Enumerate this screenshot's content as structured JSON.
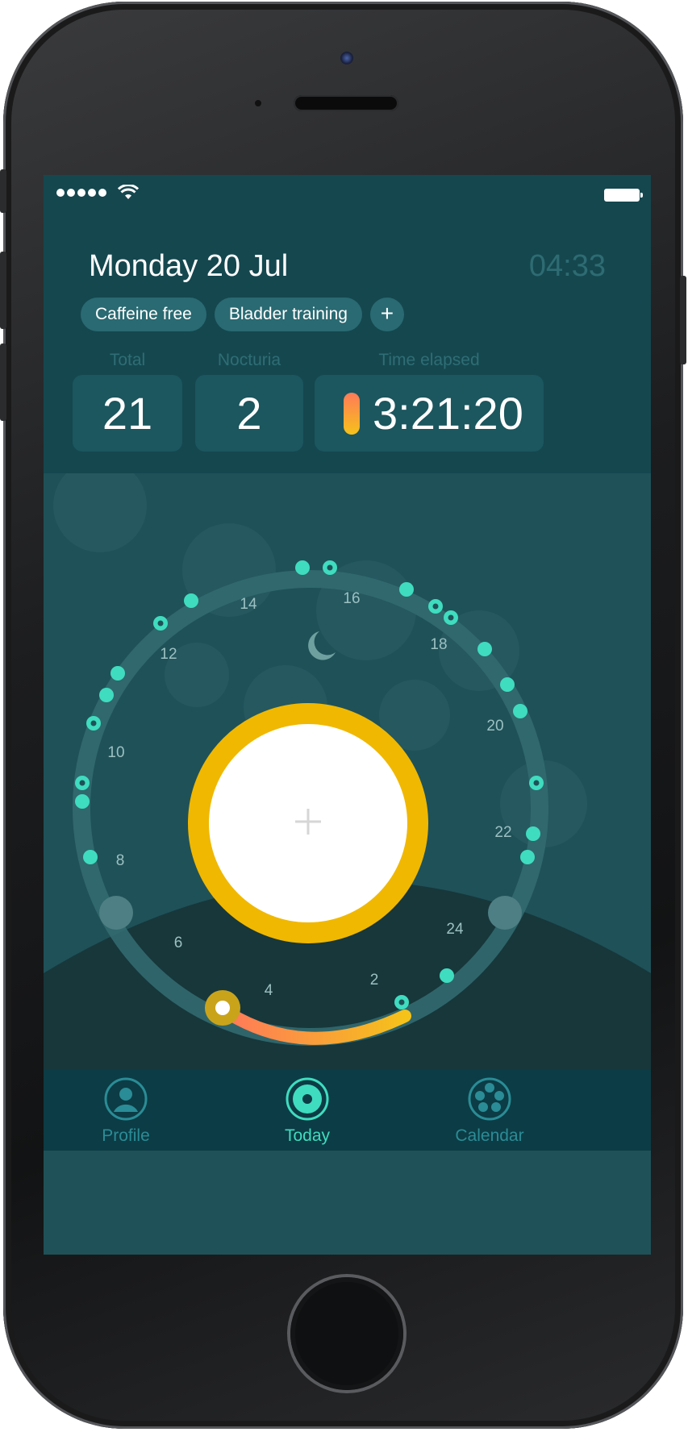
{
  "header": {
    "date": "Monday 20 Jul",
    "time": "04:33",
    "chips": [
      "Caffeine free",
      "Bladder training"
    ],
    "add_chip": "+"
  },
  "stats": {
    "total_label": "Total",
    "total_value": "21",
    "nocturia_label": "Nocturia",
    "nocturia_value": "2",
    "elapsed_label": "Time elapsed",
    "elapsed_value": "3:21:20"
  },
  "clock": {
    "hour_labels": [
      "2",
      "4",
      "6",
      "8",
      "10",
      "12",
      "14",
      "16",
      "18",
      "20",
      "22",
      "24"
    ],
    "center_icon": "plus-icon",
    "moon_icon": "moon-icon"
  },
  "tabs": [
    {
      "label": "Profile",
      "icon": "profile-icon",
      "active": false
    },
    {
      "label": "Today",
      "icon": "today-icon",
      "active": true
    },
    {
      "label": "Calendar",
      "icon": "calendar-icon",
      "active": false
    }
  ],
  "colors": {
    "accent": "#3fdcc0",
    "ring": "#f0b800",
    "background": "#1f5158",
    "header": "#15474f",
    "tab_bar": "#0c3c45"
  }
}
